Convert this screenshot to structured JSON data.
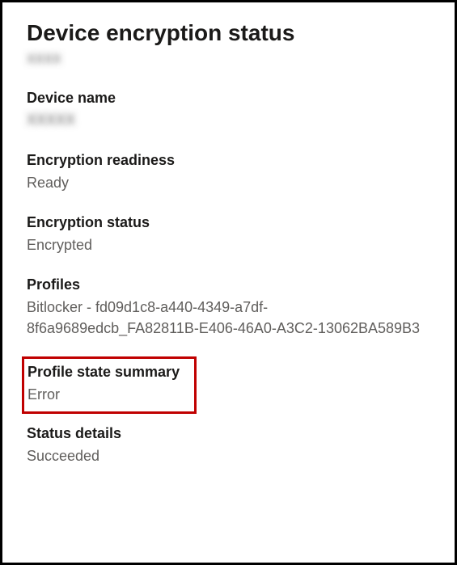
{
  "page": {
    "title": "Device encryption status",
    "redacted_subtitle": "XXXX"
  },
  "device_name": {
    "label": "Device name",
    "value_redacted": "XXXXX"
  },
  "encryption_readiness": {
    "label": "Encryption readiness",
    "value": "Ready"
  },
  "encryption_status": {
    "label": "Encryption status",
    "value": "Encrypted"
  },
  "profiles": {
    "label": "Profiles",
    "value": "Bitlocker - fd09d1c8-a440-4349-a7df-8f6a9689edcb_FA82811B-E406-46A0-A3C2-13062BA589B3"
  },
  "profile_state_summary": {
    "label": "Profile state summary",
    "value": "Error"
  },
  "status_details": {
    "label": "Status details",
    "value": "Succeeded"
  }
}
